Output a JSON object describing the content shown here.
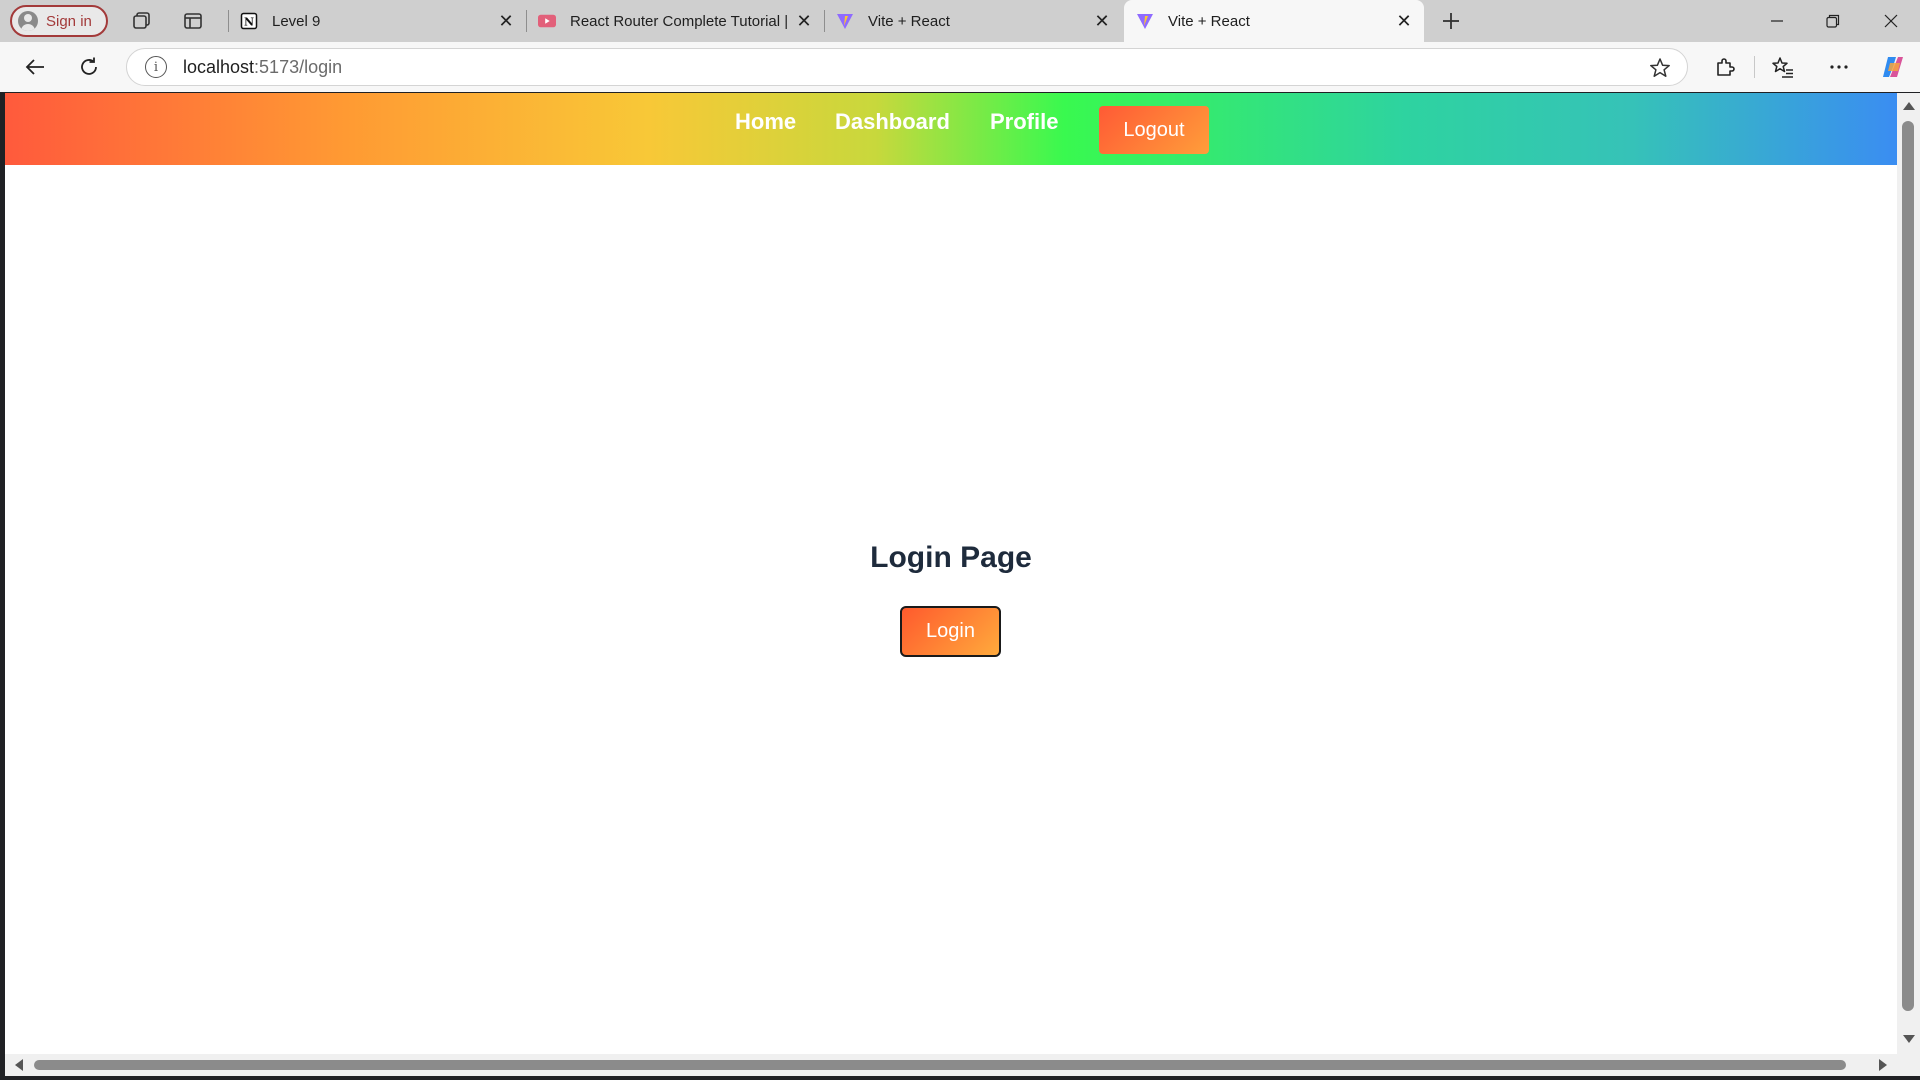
{
  "browser": {
    "signin_label": "Sign in",
    "tabs": [
      {
        "title": "Level 9",
        "icon": "notion-icon"
      },
      {
        "title": "React Router Complete Tutorial | ",
        "icon": "youtube-icon"
      },
      {
        "title": "Vite + React",
        "icon": "vite-icon"
      },
      {
        "title": "Vite + React",
        "icon": "vite-icon",
        "active": true
      }
    ],
    "url_host": "localhost",
    "url_path": ":5173/login"
  },
  "navbar": {
    "links": [
      "Home",
      "Dashboard",
      "Profile"
    ],
    "logout_label": "Logout",
    "gradient": [
      "#ff5a3c",
      "#ff9a33",
      "#f8c837",
      "#39f94f",
      "#3a8df2"
    ]
  },
  "main": {
    "title": "Login Page",
    "login_label": "Login"
  },
  "colors": {
    "title": "#1e2b3c",
    "button_gradient_start": "#ff5a2d",
    "button_gradient_end": "#ffaa3c"
  }
}
